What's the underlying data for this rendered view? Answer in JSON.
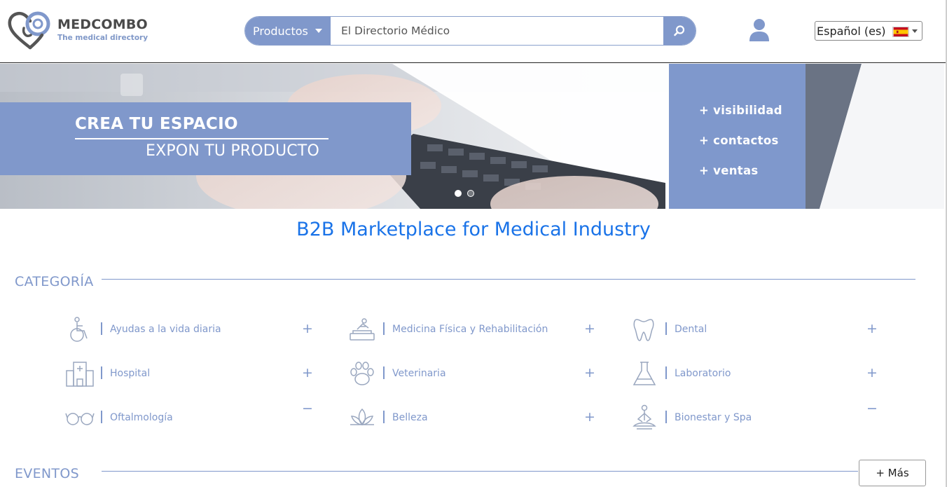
{
  "header": {
    "logo_title": "MEDCOMBO",
    "logo_subtitle": "The medical directory",
    "search": {
      "category_label": "Productos",
      "value": "",
      "placeholder": "El Directorio Médico"
    },
    "language": {
      "label": "Español (es)",
      "flag": "spain-flag"
    }
  },
  "banner": {
    "title": "CREA TU ESPACIO",
    "subtitle": "EXPON TU PRODUCTO",
    "bullets": [
      "+ visibilidad",
      "+ contactos",
      "+ ventas"
    ],
    "active_slide": 1,
    "slide_count": 2
  },
  "headline": "B2B Marketplace for Medical Industry",
  "categories_section": {
    "label": "CATEGORÍA",
    "items": [
      {
        "label": "Ayudas a la vida diaria",
        "toggle": "+",
        "icon": "wheelchair-icon"
      },
      {
        "label": "Medicina Física y Rehabilitación",
        "toggle": "+",
        "icon": "rehabilitation-icon"
      },
      {
        "label": "Dental",
        "toggle": "+",
        "icon": "tooth-icon"
      },
      {
        "label": "Hospital",
        "toggle": "+",
        "icon": "hospital-icon"
      },
      {
        "label": "Veterinaria",
        "toggle": "+",
        "icon": "paw-icon"
      },
      {
        "label": "Laboratorio",
        "toggle": "+",
        "icon": "flask-icon"
      },
      {
        "label": "Oftalmología",
        "toggle": "−",
        "icon": "glasses-icon"
      },
      {
        "label": "Belleza",
        "toggle": "+",
        "icon": "lotus-icon"
      },
      {
        "label": "Bionestar y Spa",
        "toggle": "−",
        "icon": "meditation-icon"
      }
    ]
  },
  "events_section": {
    "label": "EVENTOS",
    "more_button": "+ Más"
  },
  "colors": {
    "brand": "#8098cb",
    "headline": "#1a73e8",
    "logo_text": "#4a4a4a"
  }
}
